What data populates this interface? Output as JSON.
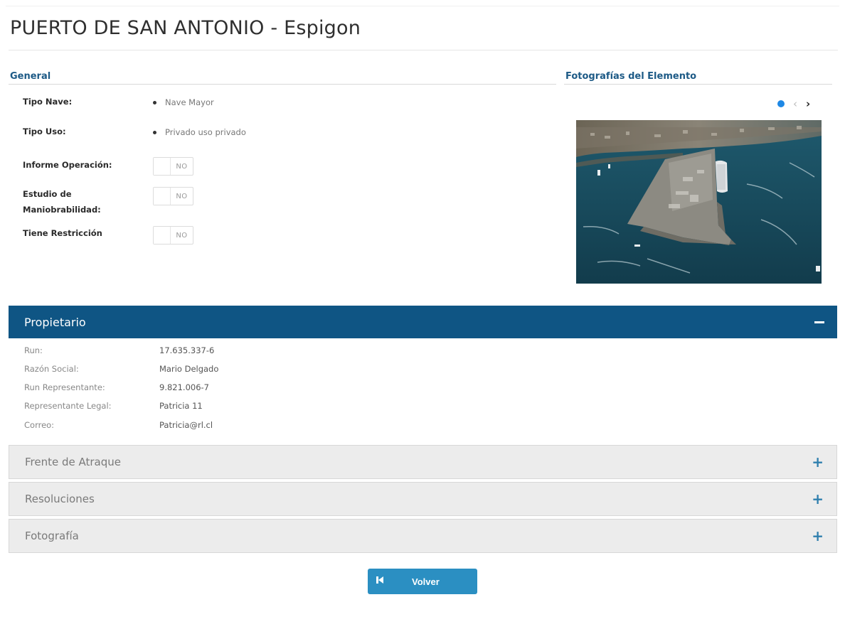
{
  "page": {
    "title": "PUERTO DE SAN ANTONIO - Espigon"
  },
  "general": {
    "heading": "General",
    "tipo_nave_label": "Tipo Nave:",
    "tipo_nave_value": "Nave Mayor",
    "tipo_uso_label": "Tipo Uso:",
    "tipo_uso_value": "Privado uso privado",
    "informe_label": "Informe Operación:",
    "informe_value": "NO",
    "estudio_label_1": "Estudio de",
    "estudio_label_2": "Maniobrabilidad:",
    "estudio_value": "NO",
    "restriccion_label": "Tiene Restricción",
    "restriccion_value": "NO"
  },
  "fotos": {
    "heading": "Fotografías del Elemento",
    "prev_icon": "chevron-left-icon",
    "next_icon": "chevron-right-icon"
  },
  "propietario": {
    "title": "Propietario",
    "run_label": "Run:",
    "run_value": "17.635.337-6",
    "razon_label": "Razón Social:",
    "razon_value": "Mario Delgado",
    "run_rep_label": "Run Representante:",
    "run_rep_value": "9.821.006-7",
    "rep_legal_label": "Representante Legal:",
    "rep_legal_value": "Patricia 11",
    "correo_label": "Correo:",
    "correo_value": "Patricia@rl.cl"
  },
  "panels": {
    "frente": "Frente de Atraque",
    "resoluciones": "Resoluciones",
    "fotografia": "Fotografía"
  },
  "actions": {
    "volver": "Volver",
    "volver_icon": "back-to-start-icon"
  },
  "colors": {
    "header_active": "#0f5584",
    "accent": "#1d5a86",
    "button": "#2b8fc2"
  }
}
